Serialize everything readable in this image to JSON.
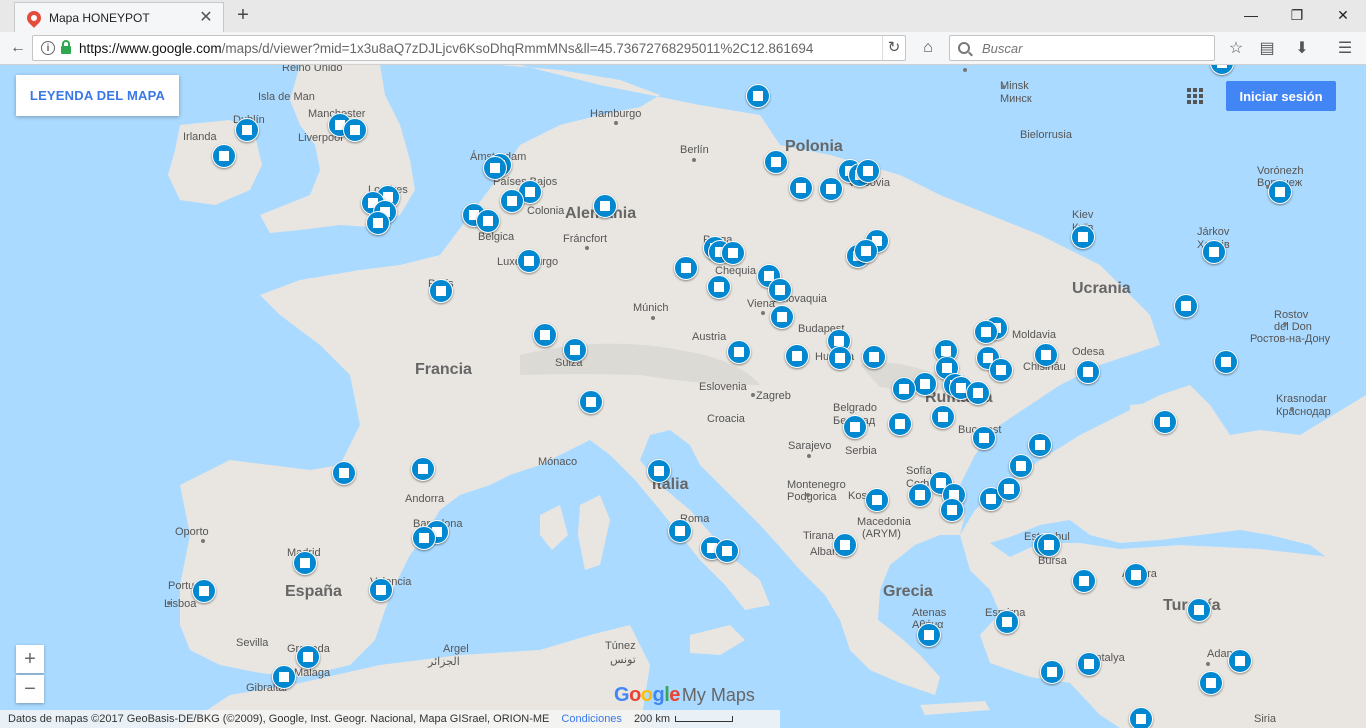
{
  "browser": {
    "tab_title": "Mapa HONEYPOT",
    "url_host": "https://www.google.com",
    "url_path": "/maps/d/viewer?mid=1x3u8aQ7zDJLjcv6KsoDhqRmmMNs&ll=45.73672768295011%2C12.861694",
    "search_placeholder": "Buscar"
  },
  "map_ui": {
    "legend_button": "LEYENDA DEL MAPA",
    "signin_button": "Iniciar sesión",
    "zoom_in": "+",
    "zoom_out": "−",
    "attribution": "Datos de mapas ©2017 GeoBasis-DE/BKG (©2009), Google, Inst. Geogr. Nacional, Mapa GISrael, ORION-ME",
    "terms": "Condiciones",
    "scale": "200 km",
    "logo_google": "Google",
    "logo_mymaps": "My Maps"
  },
  "labels": {
    "countries": [
      "Polonia",
      "Alemania",
      "Francia",
      "España",
      "Ucrania",
      "Italia",
      "Grecia",
      "Turquía",
      "Rumanía"
    ],
    "places": [
      "Reino Unido",
      "Isla de Man",
      "Manchester",
      "Liverpool",
      "Irlanda",
      "Dublín",
      "Londres",
      "Hamburgo",
      "Berlín",
      "Minsk",
      "Минск",
      "Bielorrusia",
      "Ámsterdam",
      "Países Bajos",
      "Colonia",
      "Bélgica",
      "Varsovia",
      "Vorónezh",
      "Воронеж",
      "Kiev",
      "Київ",
      "Járkov",
      "Харків",
      "Praga",
      "Chequia",
      "Fráncfort",
      "Luxemburgo",
      "París",
      "Viena",
      "Eslovaquia",
      "Múnich",
      "Budapest",
      "Hungría",
      "Moldavia",
      "Chisináu",
      "Odesa",
      "Rostov del Don",
      "Ростов-на-Дону",
      "Austria",
      "Suiza",
      "Eslovenia",
      "Zagreb",
      "Croacia",
      "Belgrado",
      "Београд",
      "Serbia",
      "Bucarest",
      "Krasnodar",
      "Краснодар",
      "Sarajevo",
      "Mónaco",
      "Andorra",
      "Montenegro",
      "Podgorica",
      "Sofía",
      "София",
      "Kosovo",
      "Macedonia (ARYM)",
      "Tirana",
      "Albania",
      "Roma",
      "Barcelona",
      "Oporto",
      "Madrid",
      "Portugal",
      "Lisboa",
      "Valencia",
      "Estambul",
      "Bursa",
      "Atenas",
      "Αθήνα",
      "Esmirna",
      "Ankara",
      "Sevilla",
      "Granada",
      "Málaga",
      "Gibraltar",
      "Argel",
      "الجزائر",
      "Túnez",
      "تونس",
      "Antalya",
      "Adana",
      "Siria"
    ]
  },
  "markers_count": 96,
  "colors": {
    "water": "#aadaff",
    "land": "#e9e6e1",
    "marker": "#0288d1",
    "signin": "#4285f4",
    "legend_text": "#3b78e7"
  }
}
